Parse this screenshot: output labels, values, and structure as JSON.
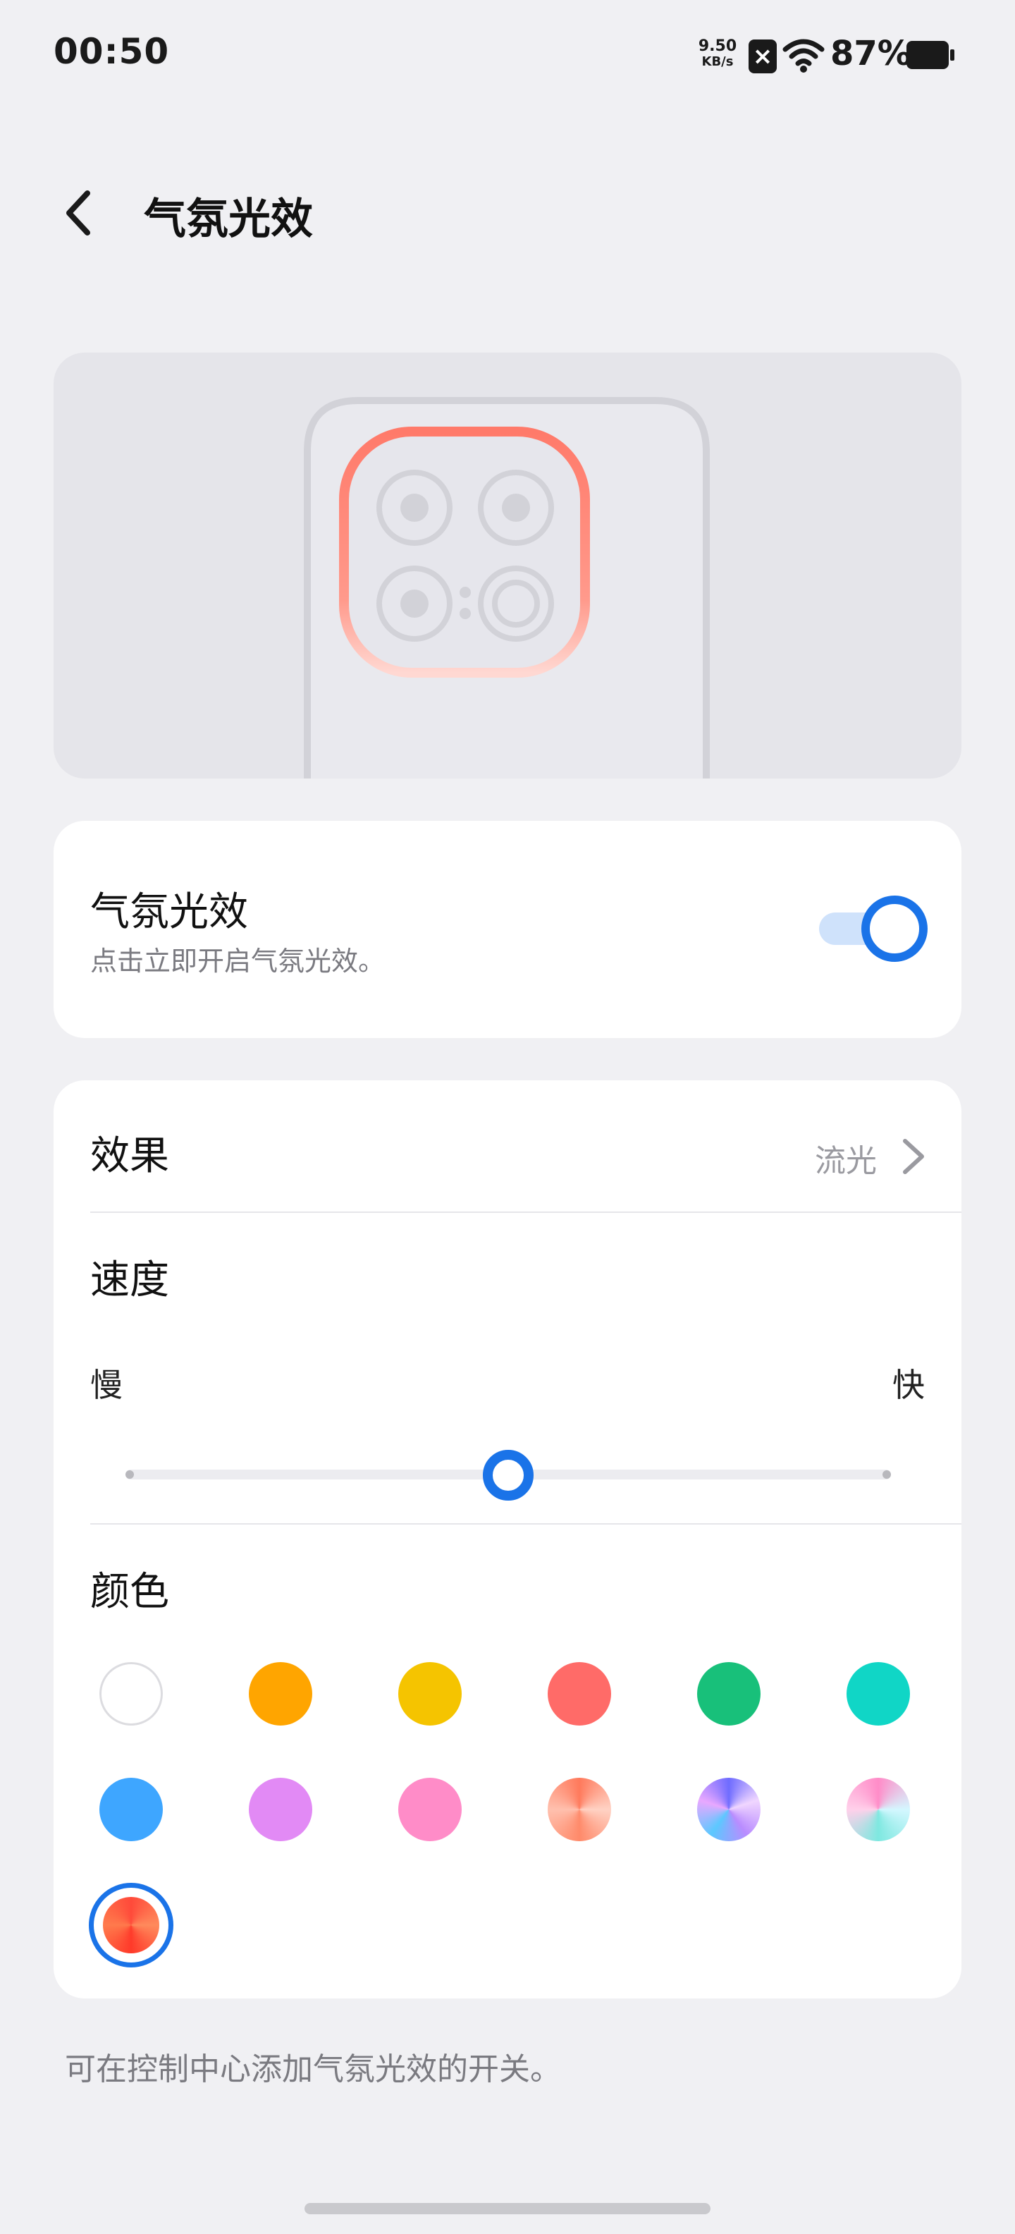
{
  "status_bar": {
    "time": "00:50",
    "net_speed_value": "9.50",
    "net_speed_unit": "KB/s",
    "battery_percent": "87%"
  },
  "header": {
    "back_icon": "chevron-left-icon",
    "title": "气氛光效"
  },
  "toggle_card": {
    "title": "气氛光效",
    "subtitle": "点击立即开启气氛光效。",
    "enabled": true
  },
  "settings": {
    "effect_label": "效果",
    "effect_value": "流光",
    "speed_label": "速度",
    "speed_slow": "慢",
    "speed_fast": "快",
    "speed_value_fraction": 0.5,
    "color_label": "颜色",
    "colors": [
      {
        "name": "white",
        "fill": "#ffffff"
      },
      {
        "name": "orange",
        "fill": "#ffa500"
      },
      {
        "name": "yellow",
        "fill": "#f5c400"
      },
      {
        "name": "coral",
        "fill": "#ff6b68"
      },
      {
        "name": "green",
        "fill": "#18c07a"
      },
      {
        "name": "cyan",
        "fill": "#10d6c6"
      },
      {
        "name": "blue",
        "fill": "#3ea6ff"
      },
      {
        "name": "violet",
        "fill": "#e28af5"
      },
      {
        "name": "pink",
        "fill": "#ff8cc8"
      },
      {
        "name": "peach-gradient",
        "fill": "conic"
      },
      {
        "name": "purple-blue-gradient",
        "fill": "conic"
      },
      {
        "name": "pink-cyan-gradient",
        "fill": "conic"
      },
      {
        "name": "red-orange-gradient",
        "fill": "conic"
      }
    ],
    "selected_color": "red-orange-gradient"
  },
  "footnote": "可在控制中心添加气氛光效的开关。",
  "accent_color": "#1a73e8"
}
